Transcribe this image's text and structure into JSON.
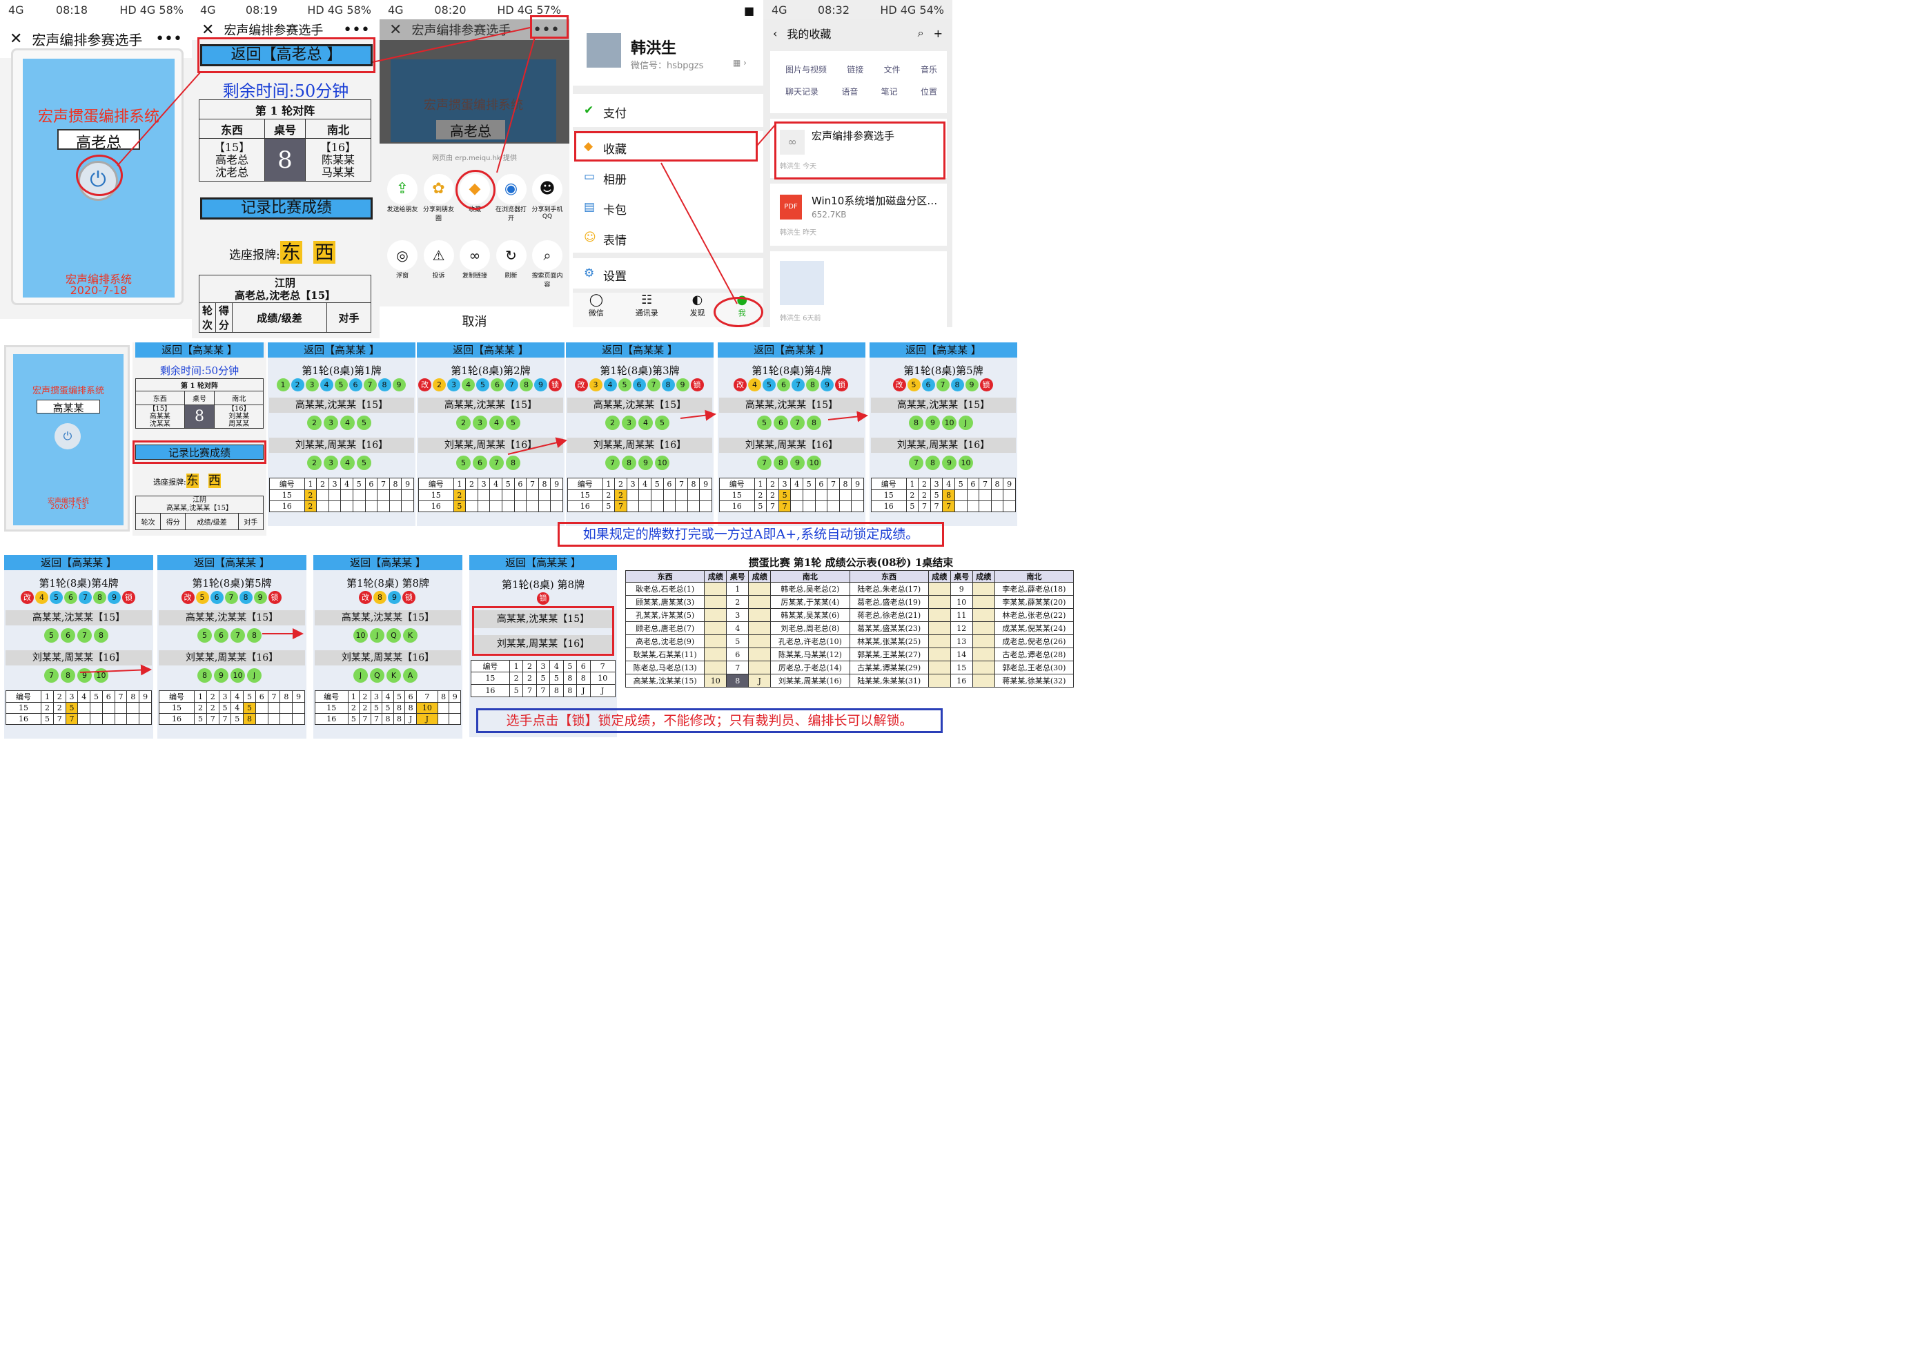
{
  "status1": {
    "time": "08:18",
    "right": "HD 4G 58%"
  },
  "status2": {
    "time": "08:19",
    "right": "HD 4G 58%"
  },
  "status3": {
    "time": "08:20",
    "right": "HD 4G 57%"
  },
  "status5": {
    "time": "08:32",
    "right": "HD 4G 54%"
  },
  "miniapp_title": "宏声编排参赛选手",
  "login": {
    "system": "宏声掼蛋编排系统",
    "name": "高老总",
    "footer1": "宏声编排系统",
    "footer2": "2020-7-18"
  },
  "main": {
    "back": "返回【高老总 】",
    "timer": "剩余时间:50分钟",
    "round_title": "第 1 轮对阵",
    "col_east": "东西",
    "col_table": "桌号",
    "col_south": "南北",
    "east_team": "【15】",
    "east_p1": "高老总",
    "east_p2": "沈老总",
    "table_no": "8",
    "south_team": "【16】",
    "south_p1": "陈某某",
    "south_p2": "马某某",
    "record_btn": "记录比赛成绩",
    "seat_label": "选座报牌:",
    "east": "东",
    "west": "西",
    "team_city": "江阴",
    "team_line": "高老总,沈老总【15】",
    "h1": "轮次",
    "h2": "得分",
    "h3": "成绩/级差",
    "h4": "对手"
  },
  "share": {
    "provider": "网页由 erp.meiqu.hk 提供",
    "r1": [
      "发送给朋友",
      "分享到朋友圈",
      "收藏",
      "在浏览器打开",
      "分享到手机QQ"
    ],
    "r2": [
      "浮窗",
      "投诉",
      "复制链接",
      "刷新",
      "搜索页面内容"
    ],
    "cancel": "取消"
  },
  "profile": {
    "name": "韩洪生",
    "wxid": "微信号：hsbpgzs",
    "menu": [
      "支付",
      "收藏",
      "相册",
      "卡包",
      "表情",
      "设置"
    ],
    "tabs": [
      "微信",
      "通讯录",
      "发现",
      "我"
    ]
  },
  "fav": {
    "title": "我的收藏",
    "cats1": [
      "图片与视频",
      "链接",
      "文件",
      "音乐"
    ],
    "cats2": [
      "聊天记录",
      "语音",
      "笔记",
      "位置"
    ],
    "item1": "宏声编排参赛选手",
    "item1_meta": "韩洪生  今天",
    "item2": "Win10系统增加磁盘分区…",
    "item2_size": "652.7KB",
    "item2_meta": "韩洪生  昨天",
    "item3_meta": "韩洪生  6天前",
    "pdf": "PDF"
  },
  "small": {
    "system": "宏声掼蛋编排系统",
    "name": "高某某",
    "footer1": "宏声编排系统",
    "footer2": "2020-7-13",
    "back": "返回【高某某 】",
    "timer": "剩余时间:50分钟",
    "round_title": "第 1 轮对阵",
    "east_team": "【15】",
    "east_p1": "高某某",
    "east_p2": "沈某某",
    "table_no": "8",
    "south_team": "【16】",
    "south_p1": "刘某某",
    "south_p2": "周某某",
    "record_btn": "记录比赛成绩",
    "team_city": "江阴",
    "team_line": "高某某,沈某某【15】"
  },
  "score": {
    "back": "返回【高某某 】",
    "team1": "高某某,沈某某【15】",
    "team2": "刘某某,周某某【16】",
    "gai": "改",
    "suo": "锁",
    "qi": "弃",
    "grid_head": [
      "编号",
      "1",
      "2",
      "3",
      "4",
      "5",
      "6",
      "7",
      "8",
      "9"
    ],
    "rounds": [
      {
        "title": "第1轮(8桌)第1牌",
        "top": [
          "1",
          "2",
          "3",
          "4",
          "5",
          "6",
          "7",
          "8",
          "9"
        ],
        "t1": [
          "2",
          "3",
          "4",
          "5"
        ],
        "t2": [
          "2",
          "3",
          "4",
          "5"
        ],
        "r15": [
          "15",
          "2",
          "",
          "",
          "",
          "",
          "",
          "",
          "",
          ""
        ],
        "r16": [
          "16",
          "2",
          "",
          "",
          "",
          "",
          "",
          "",
          "",
          ""
        ]
      },
      {
        "title": "第1轮(8桌)第2牌",
        "top": [
          "2",
          "3",
          "4",
          "5",
          "6",
          "7",
          "8",
          "9"
        ],
        "t1": [
          "2",
          "3",
          "4",
          "5"
        ],
        "t2": [
          "5",
          "6",
          "7",
          "8"
        ],
        "r15": [
          "15",
          "2",
          "",
          "",
          "",
          "",
          "",
          "",
          "",
          ""
        ],
        "r16": [
          "16",
          "5",
          "",
          "",
          "",
          "",
          "",
          "",
          "",
          ""
        ]
      },
      {
        "title": "第1轮(8桌)第3牌",
        "top": [
          "3",
          "4",
          "5",
          "6",
          "7",
          "8",
          "9"
        ],
        "t1": [
          "2",
          "3",
          "4",
          "5"
        ],
        "t2": [
          "7",
          "8",
          "9",
          "10"
        ],
        "r15": [
          "15",
          "2",
          "2",
          "",
          "",
          "",
          "",
          "",
          "",
          ""
        ],
        "r16": [
          "16",
          "5",
          "7",
          "",
          "",
          "",
          "",
          "",
          "",
          ""
        ]
      },
      {
        "title": "第1轮(8桌)第4牌",
        "top": [
          "4",
          "5",
          "6",
          "7",
          "8",
          "9"
        ],
        "t1": [
          "5",
          "6",
          "7",
          "8"
        ],
        "t2": [
          "7",
          "8",
          "9",
          "10"
        ],
        "r15": [
          "15",
          "2",
          "2",
          "5",
          "",
          "",
          "",
          "",
          "",
          ""
        ],
        "r16": [
          "16",
          "5",
          "7",
          "7",
          "",
          "",
          "",
          "",
          "",
          ""
        ]
      },
      {
        "title": "第1轮(8桌)第5牌",
        "top": [
          "5",
          "6",
          "7",
          "8",
          "9"
        ],
        "t1": [
          "8",
          "9",
          "10",
          "J"
        ],
        "t2": [
          "7",
          "8",
          "9",
          "10"
        ],
        "r15": [
          "15",
          "2",
          "2",
          "5",
          "8",
          "",
          "",
          "",
          "",
          ""
        ],
        "r16": [
          "16",
          "5",
          "7",
          "7",
          "7",
          "",
          "",
          "",
          "",
          ""
        ]
      }
    ],
    "rounds2": [
      {
        "title": "第1轮(8桌)第4牌",
        "top": [
          "4",
          "5",
          "6",
          "7",
          "8",
          "9"
        ],
        "t1": [
          "5",
          "6",
          "7",
          "8"
        ],
        "t2": [
          "7",
          "8",
          "9",
          "10"
        ],
        "r15": [
          "15",
          "2",
          "2",
          "5",
          "",
          "",
          "",
          "",
          "",
          ""
        ],
        "r16": [
          "16",
          "5",
          "7",
          "7",
          "",
          "",
          "",
          "",
          "",
          ""
        ]
      },
      {
        "title": "第1轮(8桌)第5牌",
        "top": [
          "5",
          "6",
          "7",
          "8",
          "9"
        ],
        "t1": [
          "5",
          "6",
          "7",
          "8"
        ],
        "t2": [
          "8",
          "9",
          "10",
          "J"
        ],
        "r15": [
          "15",
          "2",
          "2",
          "5",
          "4",
          "5",
          "",
          "",
          "",
          ""
        ],
        "r16": [
          "16",
          "5",
          "7",
          "7",
          "5",
          "8",
          "",
          "",
          "",
          ""
        ]
      },
      {
        "title": "第1轮(8桌) 第8牌",
        "top": [
          "8",
          "9"
        ],
        "t1": [
          "10",
          "J",
          "Q",
          "K"
        ],
        "t2": [
          "J",
          "Q",
          "K",
          "A"
        ],
        "r15": [
          "15",
          "2",
          "2",
          "5",
          "5",
          "8",
          "8",
          "10",
          "",
          ""
        ],
        "r16": [
          "16",
          "5",
          "7",
          "7",
          "8",
          "8",
          "J",
          "J",
          "",
          ""
        ]
      }
    ],
    "final": {
      "title": "第1轮(8桌) 第8牌",
      "head": [
        "编号",
        "1",
        "2",
        "3",
        "4",
        "5",
        "6",
        "7"
      ],
      "r15": [
        "15",
        "2",
        "2",
        "5",
        "5",
        "8",
        "8",
        "10"
      ],
      "r16": [
        "16",
        "5",
        "7",
        "7",
        "8",
        "8",
        "J",
        "J"
      ]
    }
  },
  "note1": "如果规定的牌数打完或一方过A即A+,系统自动锁定成绩。",
  "note2": "选手点击【锁】锁定成绩，不能修改；只有裁判员、编排长可以解锁。",
  "result": {
    "title": "掼蛋比赛  第1轮  成绩公示表(08秒) 1桌结束",
    "head": [
      "东西",
      "成绩",
      "桌号",
      "成绩",
      "南北",
      "东西",
      "成绩",
      "桌号",
      "成绩",
      "南北"
    ],
    "rows": [
      [
        "耿老总,石老总(1)",
        "",
        "1",
        "",
        "韩老总,吴老总(2)",
        "陆老总,朱老总(17)",
        "",
        "9",
        "",
        "李老总,薛老总(18)"
      ],
      [
        "顾某某,唐某某(3)",
        "",
        "2",
        "",
        "厉某某,于某某(4)",
        "葛老总,盛老总(19)",
        "",
        "10",
        "",
        "李某某,薛某某(20)"
      ],
      [
        "孔某某,许某某(5)",
        "",
        "3",
        "",
        "韩某某,吴某某(6)",
        "蒋老总,徐老总(21)",
        "",
        "11",
        "",
        "林老总,张老总(22)"
      ],
      [
        "顾老总,唐老总(7)",
        "",
        "4",
        "",
        "刘老总,周老总(8)",
        "葛某某,盛某某(23)",
        "",
        "12",
        "",
        "成某某,倪某某(24)"
      ],
      [
        "高老总,沈老总(9)",
        "",
        "5",
        "",
        "孔老总,许老总(10)",
        "林某某,张某某(25)",
        "",
        "13",
        "",
        "成老总,倪老总(26)"
      ],
      [
        "耿某某,石某某(11)",
        "",
        "6",
        "",
        "陈某某,马某某(12)",
        "郭某某,王某某(27)",
        "",
        "14",
        "",
        "古老总,谭老总(28)"
      ],
      [
        "陈老总,马老总(13)",
        "",
        "7",
        "",
        "厉老总,于老总(14)",
        "古某某,谭某某(29)",
        "",
        "15",
        "",
        "郭老总,王老总(30)"
      ],
      [
        "高某某,沈某某(15)",
        "10",
        "8",
        "J",
        "刘某某,周某某(16)",
        "陆某某,朱某某(31)",
        "",
        "16",
        "",
        "蒋某某,徐某某(32)"
      ]
    ]
  }
}
